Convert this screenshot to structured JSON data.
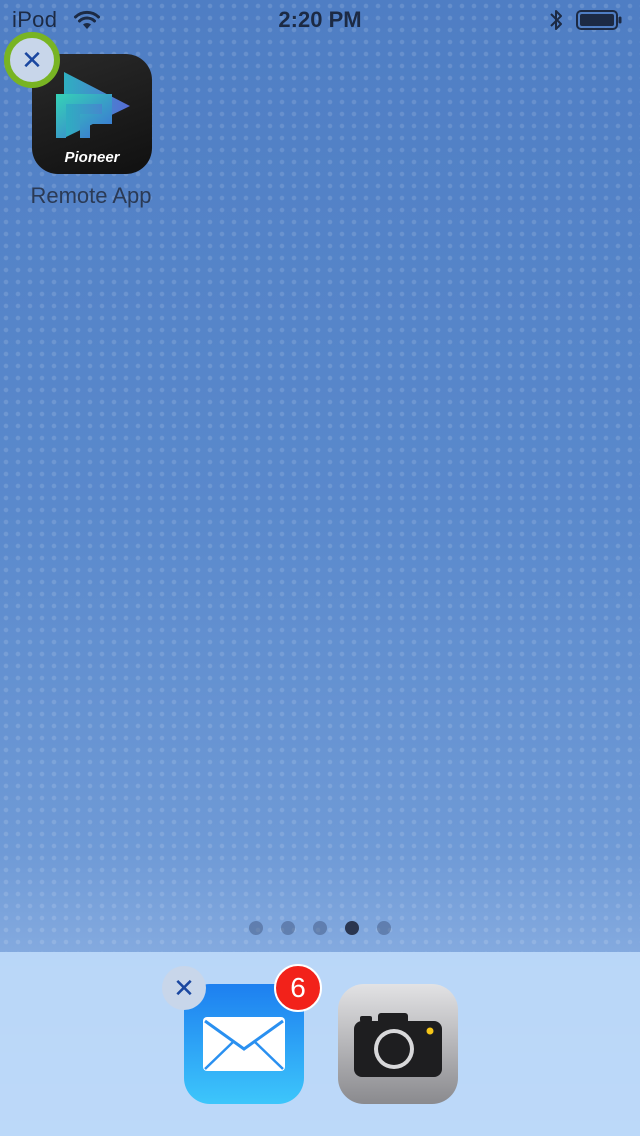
{
  "status_bar": {
    "carrier": "iPod",
    "time": "2:20 PM"
  },
  "home_apps": [
    {
      "label": "Remote App",
      "brand_text": "Pioneer",
      "delete_symbol": "✕",
      "delete_highlighted": true
    }
  ],
  "page_indicator": {
    "count": 5,
    "active_index": 3
  },
  "dock": {
    "mail": {
      "delete_symbol": "✕",
      "badge_count": "6"
    },
    "camera": {}
  },
  "colors": {
    "highlight_ring": "#78b423",
    "badge_red": "#f2221a",
    "delete_x": "#1a47a0"
  }
}
